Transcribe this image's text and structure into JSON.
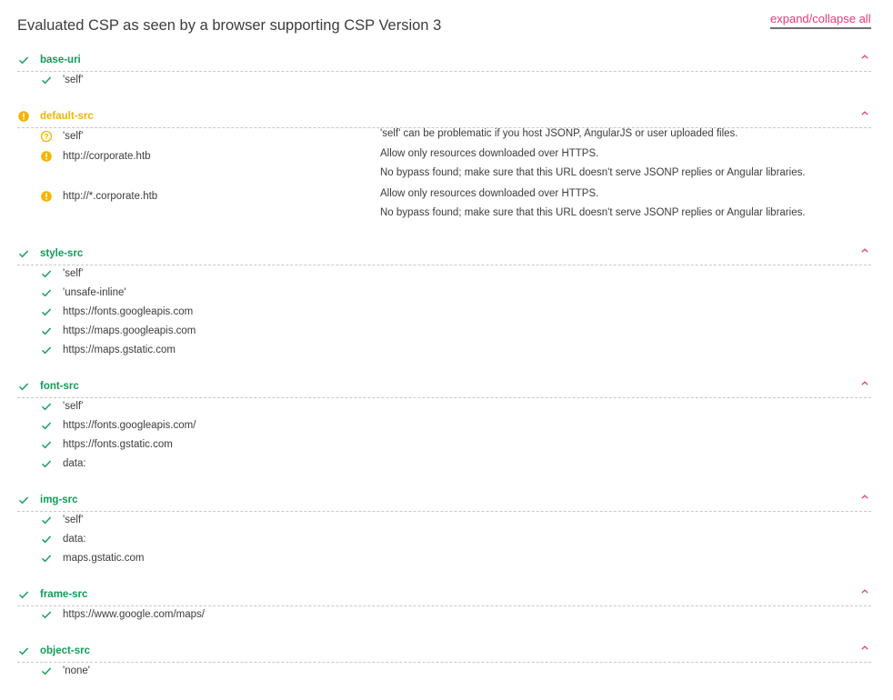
{
  "page": {
    "title": "Evaluated CSP as seen by a browser supporting CSP Version 3",
    "expand_label": "expand/collapse all"
  },
  "colors": {
    "ok": "#0f9d58",
    "warn": "#f4b400",
    "accent": "#e53a78"
  },
  "directives": [
    {
      "name": "base-uri",
      "status": "ok",
      "values": [
        {
          "text": "'self'",
          "status": "ok",
          "findings": []
        }
      ]
    },
    {
      "name": "default-src",
      "status": "warn",
      "values": [
        {
          "text": "'self'",
          "status": "possible",
          "findings": [
            "'self' can be problematic if you host JSONP, AngularJS or user uploaded files."
          ]
        },
        {
          "text": "http://corporate.htb",
          "status": "warn",
          "findings": [
            "Allow only resources downloaded over HTTPS.",
            "No bypass found; make sure that this URL doesn't serve JSONP replies or Angular libraries."
          ]
        },
        {
          "text": "http://*.corporate.htb",
          "status": "warn",
          "findings": [
            "Allow only resources downloaded over HTTPS.",
            "No bypass found; make sure that this URL doesn't serve JSONP replies or Angular libraries."
          ]
        }
      ]
    },
    {
      "name": "style-src",
      "status": "ok",
      "values": [
        {
          "text": "'self'",
          "status": "ok",
          "findings": []
        },
        {
          "text": "'unsafe-inline'",
          "status": "ok",
          "findings": []
        },
        {
          "text": "https://fonts.googleapis.com",
          "status": "ok",
          "findings": []
        },
        {
          "text": "https://maps.googleapis.com",
          "status": "ok",
          "findings": []
        },
        {
          "text": "https://maps.gstatic.com",
          "status": "ok",
          "findings": []
        }
      ]
    },
    {
      "name": "font-src",
      "status": "ok",
      "values": [
        {
          "text": "'self'",
          "status": "ok",
          "findings": []
        },
        {
          "text": "https://fonts.googleapis.com/",
          "status": "ok",
          "findings": []
        },
        {
          "text": "https://fonts.gstatic.com",
          "status": "ok",
          "findings": []
        },
        {
          "text": "data:",
          "status": "ok",
          "findings": []
        }
      ]
    },
    {
      "name": "img-src",
      "status": "ok",
      "values": [
        {
          "text": "'self'",
          "status": "ok",
          "findings": []
        },
        {
          "text": "data:",
          "status": "ok",
          "findings": []
        },
        {
          "text": "maps.gstatic.com",
          "status": "ok",
          "findings": []
        }
      ]
    },
    {
      "name": "frame-src",
      "status": "ok",
      "values": [
        {
          "text": "https://www.google.com/maps/",
          "status": "ok",
          "findings": []
        }
      ]
    },
    {
      "name": "object-src",
      "status": "ok",
      "values": [
        {
          "text": "'none'",
          "status": "ok",
          "findings": []
        }
      ]
    }
  ]
}
